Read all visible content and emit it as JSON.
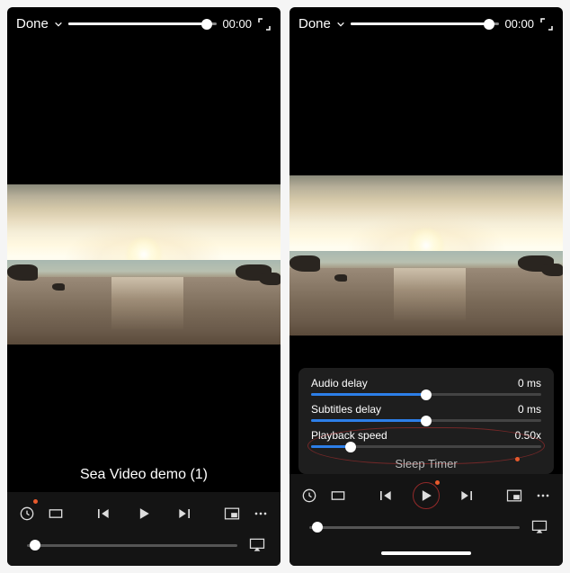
{
  "left": {
    "topbar": {
      "done": "Done",
      "time": "00:00",
      "progress_pct": 93
    },
    "video_title": "Sea Video demo (1)",
    "volume_pct": 4
  },
  "right": {
    "topbar": {
      "done": "Done",
      "time": "00:00",
      "progress_pct": 93
    },
    "settings": {
      "audio_delay": {
        "label": "Audio delay",
        "value": "0 ms",
        "pct": 50
      },
      "subtitles_delay": {
        "label": "Subtitles delay",
        "value": "0 ms",
        "pct": 50
      },
      "playback_speed": {
        "label": "Playback speed",
        "value": "0.50x",
        "pct": 17
      },
      "sleep_timer": {
        "label": "Sleep Timer"
      }
    },
    "volume_pct": 4
  },
  "chart_data": null
}
